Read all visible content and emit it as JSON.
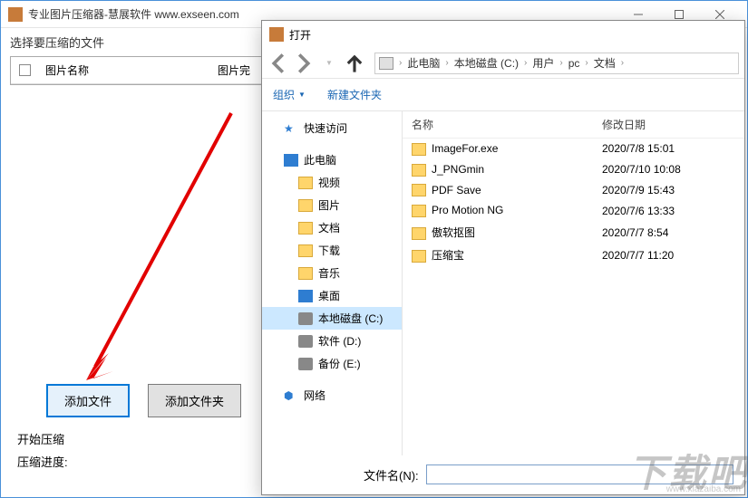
{
  "mainWindow": {
    "title": "专业图片压缩器-慧展软件 www.exseen.com",
    "sectionSelectFiles": "选择要压缩的文件",
    "tableHeaders": {
      "name": "图片名称",
      "rest": "图片完"
    },
    "addFileBtn": "添加文件",
    "addFolderBtn": "添加文件夹",
    "sectionStart": "开始压缩",
    "progressLabel": "压缩进度:"
  },
  "dialog": {
    "title": "打开",
    "breadcrumb": [
      "此电脑",
      "本地磁盘 (C:)",
      "用户",
      "pc",
      "文档"
    ],
    "toolbar": {
      "organize": "组织",
      "newFolder": "新建文件夹"
    },
    "tree": {
      "quickAccess": "快速访问",
      "thisPC": "此电脑",
      "videos": "视频",
      "pictures": "图片",
      "documents": "文档",
      "downloads": "下载",
      "music": "音乐",
      "desktop": "桌面",
      "diskC": "本地磁盘 (C:)",
      "diskD": "软件 (D:)",
      "diskE": "备份 (E:)",
      "network": "网络"
    },
    "listHeaders": {
      "name": "名称",
      "date": "修改日期"
    },
    "files": [
      {
        "name": "ImageFor.exe",
        "date": "2020/7/8 15:01"
      },
      {
        "name": "J_PNGmin",
        "date": "2020/7/10 10:08"
      },
      {
        "name": "PDF Save",
        "date": "2020/7/9 15:43"
      },
      {
        "name": "Pro Motion NG",
        "date": "2020/7/6 13:33"
      },
      {
        "name": "傲软抠图",
        "date": "2020/7/7 8:54"
      },
      {
        "name": "压缩宝",
        "date": "2020/7/7 11:20"
      }
    ],
    "filenameLabel": "文件名(N):"
  },
  "watermark": {
    "main": "下载吧",
    "sub": "www.xiazaiba.com"
  }
}
